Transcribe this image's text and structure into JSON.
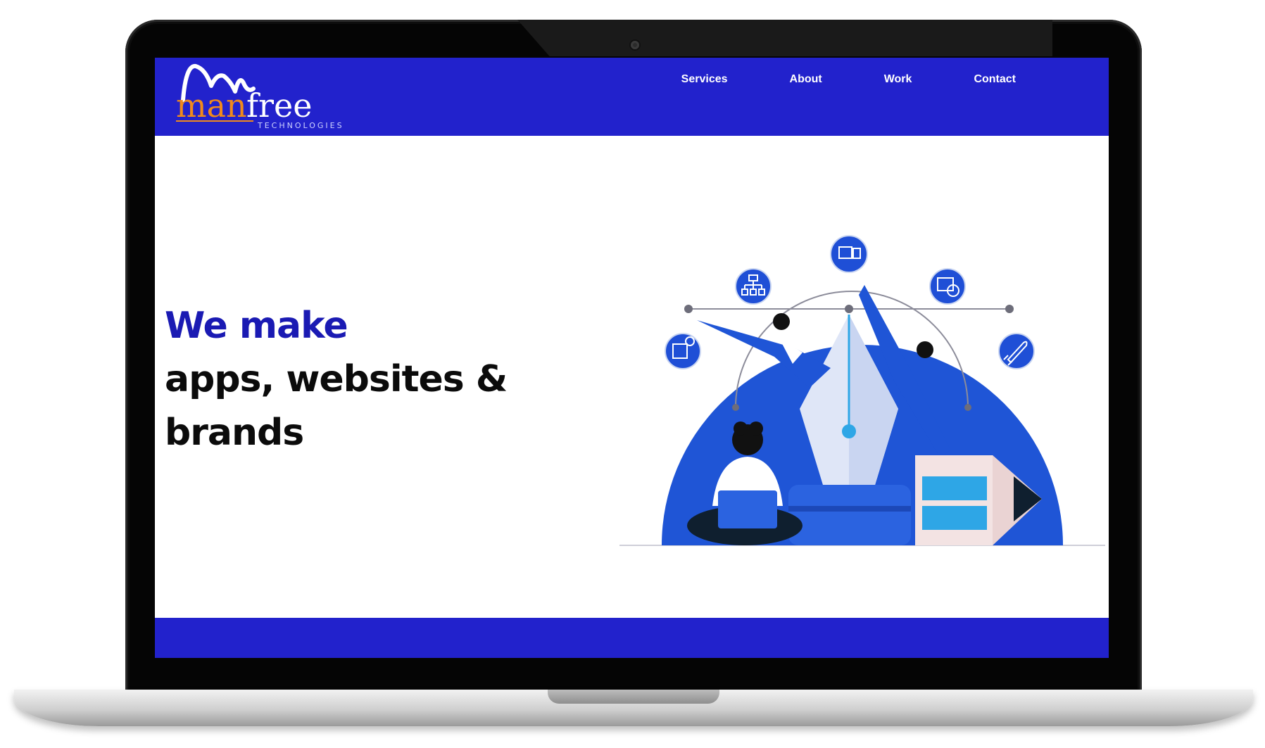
{
  "logo": {
    "word_man": "man",
    "word_free": "free",
    "sub": "TECHNOLOGIES"
  },
  "nav": {
    "items": [
      {
        "label": "Services"
      },
      {
        "label": "About"
      },
      {
        "label": "Work"
      },
      {
        "label": "Contact"
      }
    ]
  },
  "hero": {
    "line1": "We make",
    "line2": "apps, websites &",
    "line3": "brands"
  },
  "colors": {
    "brand_blue": "#2222cc",
    "headline_blue": "#1a1ab3",
    "logo_orange": "#f08a1c",
    "illustration_blue": "#1f55d6",
    "illustration_light": "#2ea6e6"
  },
  "icons": [
    "devices-icon",
    "sitemap-icon",
    "analytics-icon",
    "ideas-icon",
    "rocket-icon"
  ]
}
